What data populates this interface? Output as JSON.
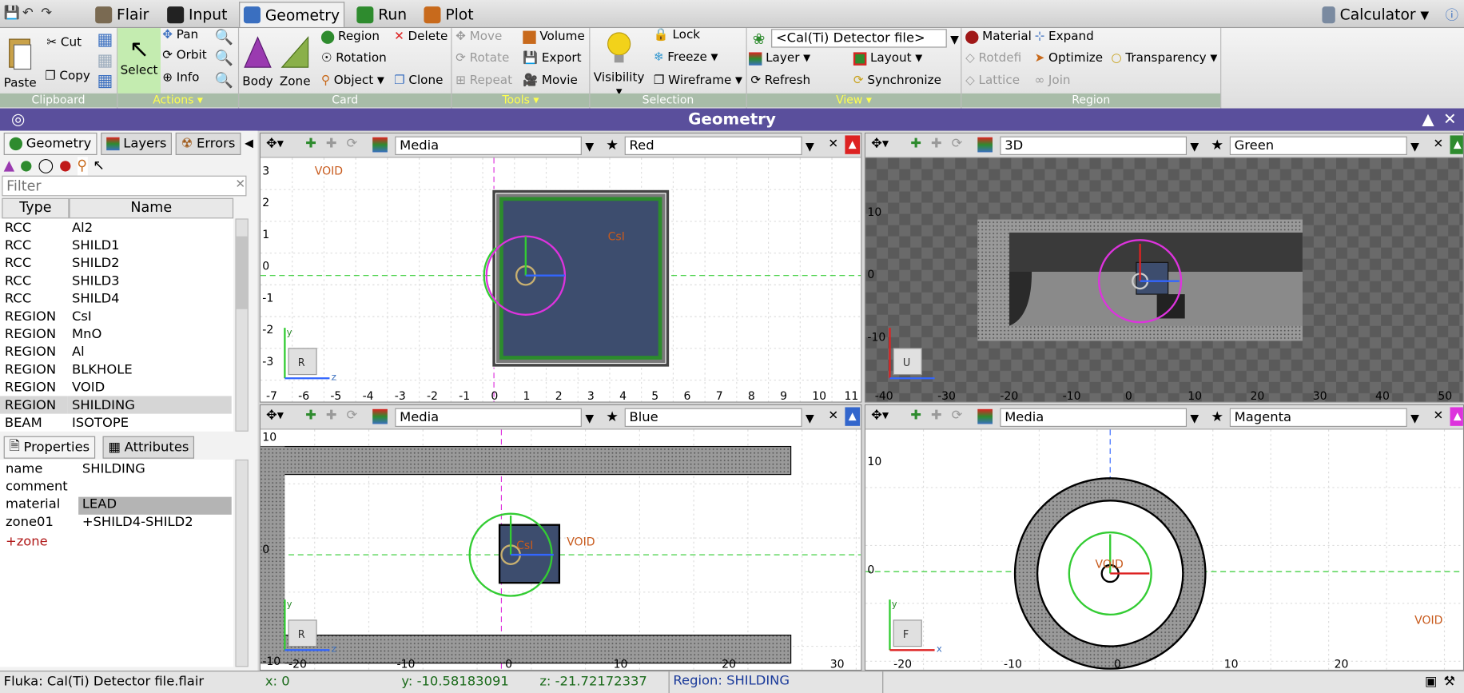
{
  "app": {
    "tabs": [
      "Flair",
      "Input",
      "Geometry",
      "Run",
      "Plot"
    ],
    "calculator": "Calculator"
  },
  "ribbon": {
    "clipboard": {
      "label": "Clipboard",
      "paste": "Paste",
      "cut": "Cut",
      "copy": "Copy"
    },
    "actions": {
      "label": "Actions",
      "select": "Select",
      "pan": "Pan",
      "orbit": "Orbit",
      "info": "Info"
    },
    "card": {
      "label": "Card",
      "body": "Body",
      "zone": "Zone",
      "region": "Region",
      "rotation": "Rotation",
      "object": "Object",
      "delete": "Delete",
      "clone": "Clone"
    },
    "tools": {
      "label": "Tools",
      "move": "Move",
      "rotate": "Rotate",
      "repeat": "Repeat",
      "volume": "Volume",
      "export": "Export",
      "movie": "Movie"
    },
    "selection": {
      "label": "Selection",
      "visibility": "Visibility",
      "lock": "Lock",
      "freeze": "Freeze",
      "wireframe": "Wireframe"
    },
    "view": {
      "label": "View",
      "file": "<Cal(Ti) Detector file>",
      "layer": "Layer",
      "layout": "Layout",
      "refresh": "Refresh",
      "synchronize": "Synchronize"
    },
    "region": {
      "label": "Region",
      "material": "Material",
      "expand": "Expand",
      "rotdefi": "Rotdefi",
      "optimize": "Optimize",
      "transparency": "Transparency",
      "lattice": "Lattice",
      "join": "Join"
    }
  },
  "window_title": "Geometry",
  "left": {
    "tabs": [
      "Geometry",
      "Layers",
      "Errors"
    ],
    "filter_placeholder": "Filter",
    "columns": [
      "Type",
      "Name"
    ],
    "rows": [
      [
        "RCC",
        "Al2"
      ],
      [
        "RCC",
        "SHILD1"
      ],
      [
        "RCC",
        "SHILD2"
      ],
      [
        "RCC",
        "SHILD3"
      ],
      [
        "RCC",
        "SHILD4"
      ],
      [
        "REGION",
        "CsI"
      ],
      [
        "REGION",
        "MnO"
      ],
      [
        "REGION",
        "Al"
      ],
      [
        "REGION",
        "BLKHOLE"
      ],
      [
        "REGION",
        "VOID"
      ],
      [
        "REGION",
        "SHILDING"
      ],
      [
        "BEAM",
        "ISOTOPE"
      ]
    ],
    "prop_tabs": [
      "Properties",
      "Attributes"
    ],
    "props": [
      [
        "name",
        "SHILDING"
      ],
      [
        "comment",
        ""
      ],
      [
        "material",
        "LEAD"
      ],
      [
        "zone01",
        "+SHILD4-SHILD2"
      ]
    ],
    "add_zone": "+zone"
  },
  "viewports": {
    "tl": {
      "layer": "Media",
      "color": "Red",
      "void": "VOID",
      "label": "CsI",
      "axis_letter": "R",
      "vaxis": "y",
      "haxis": "z",
      "xticks": [
        "-7",
        "-6",
        "-5",
        "-4",
        "-3",
        "-2",
        "-1",
        "0",
        "1",
        "2",
        "3",
        "4",
        "5",
        "6",
        "7",
        "8",
        "9",
        "10",
        "11"
      ],
      "yticks": [
        "3",
        "2",
        "1",
        "0",
        "-1",
        "-2",
        "-3"
      ]
    },
    "tr": {
      "layer": "3D",
      "color": "Green",
      "axis_letter": "U",
      "xticks": [
        "-40",
        "-30",
        "-20",
        "-10",
        "0",
        "10",
        "20",
        "30",
        "40",
        "50"
      ],
      "yticks": [
        "10",
        "0",
        "-10"
      ]
    },
    "bl": {
      "layer": "Media",
      "color": "Blue",
      "void": "VOID",
      "label": "CsI",
      "axis_letter": "R",
      "vaxis": "y",
      "haxis": "z",
      "xticks": [
        "-20",
        "-10",
        "0",
        "10",
        "20",
        "30"
      ],
      "yticks": [
        "10",
        "0",
        "-10"
      ]
    },
    "br": {
      "layer": "Media",
      "color": "Magenta",
      "void": "VOID",
      "label": "VOID",
      "axis_letter": "F",
      "vaxis": "y",
      "haxis": "x",
      "xticks": [
        "-20",
        "-10",
        "0",
        "10",
        "20"
      ],
      "yticks": [
        "10",
        "0"
      ]
    }
  },
  "status": {
    "file": "Fluka: Cal(Ti) Detector file.flair",
    "x": "x: 0",
    "y": "y: -10.58183091",
    "z": "z: -21.72172337",
    "region": "Region: SHILDING"
  }
}
